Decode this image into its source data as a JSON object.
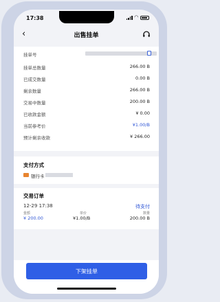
{
  "status": {
    "time": "17:38"
  },
  "header": {
    "back": "‹",
    "title": "出售挂单",
    "support_icon": "headset-icon"
  },
  "details": {
    "order_id_label": "挂单号",
    "rows": [
      {
        "label": "挂单总数量",
        "value": "266.00 B"
      },
      {
        "label": "已成交数量",
        "value": "0.00 B"
      },
      {
        "label": "剩余数量",
        "value": "266.00 B"
      },
      {
        "label": "交易中数量",
        "value": "200.00 B"
      },
      {
        "label": "已收款金额",
        "value": "¥ 0.00"
      },
      {
        "label": "当前参考价",
        "value": "¥1.00/B"
      },
      {
        "label": "预计剩余收款",
        "value": "¥ 266.00"
      }
    ]
  },
  "payment": {
    "title": "支付方式",
    "method": "银行卡"
  },
  "trade_orders": {
    "title": "交易订单",
    "date": "12-29 17:38",
    "status": "待支付",
    "amount_label": "金额",
    "amount": "¥ 200.00",
    "price_label": "单价",
    "price": "¥1.00/B",
    "qty_label": "数量",
    "qty": "200.00 B"
  },
  "action": {
    "label": "下架挂单"
  },
  "colors": {
    "accent": "#2f5fe6",
    "link": "#2f56d6",
    "bank": "#e8852f"
  }
}
